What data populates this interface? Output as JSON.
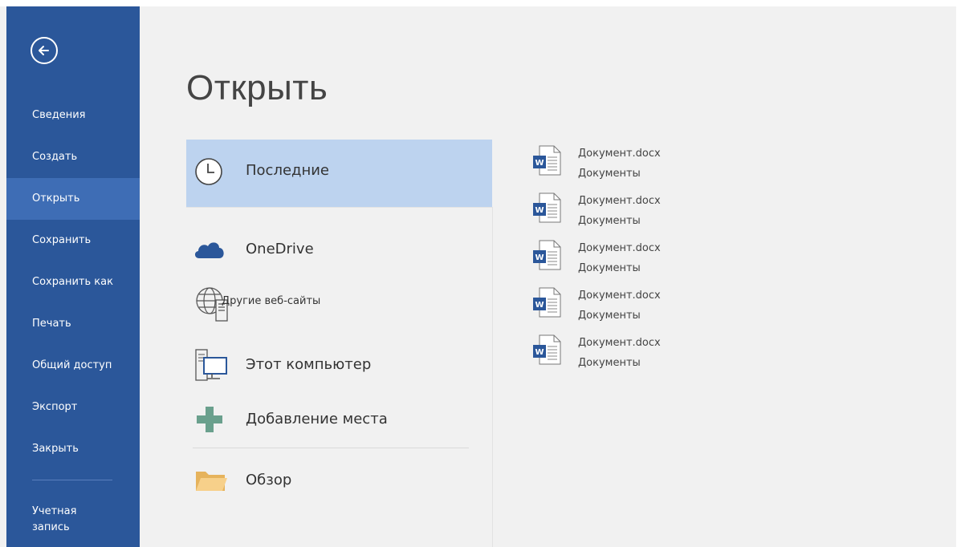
{
  "backstage": {
    "title": "Открыть"
  },
  "nav": {
    "items": [
      {
        "label": "Сведения"
      },
      {
        "label": "Создать"
      },
      {
        "label": "Открыть"
      },
      {
        "label": "Сохранить"
      },
      {
        "label": "Сохранить как"
      },
      {
        "label": "Печать"
      },
      {
        "label": "Общий доступ"
      },
      {
        "label": "Экспорт"
      },
      {
        "label": "Закрыть"
      }
    ],
    "account_line1": "Учетная",
    "account_line2": "запись",
    "active_item": "Открыть"
  },
  "places": {
    "recent": {
      "label": "Последние",
      "icon": "clock-icon"
    },
    "onedrive": {
      "label": "OneDrive",
      "icon": "cloud-icon"
    },
    "other_sites": {
      "label": "Другие веб-сайты",
      "icon": "globe-server-icon"
    },
    "this_pc": {
      "label": "Этот компьютер",
      "icon": "computer-icon"
    },
    "add_place": {
      "label": "Добавление места",
      "icon": "plus-icon"
    },
    "browse": {
      "label": "Обзор",
      "icon": "folder-icon"
    }
  },
  "recent_files": [
    {
      "name": "Документ.docx",
      "location": "Документы"
    },
    {
      "name": "Документ.docx",
      "location": "Документы"
    },
    {
      "name": "Документ.docx",
      "location": "Документы"
    },
    {
      "name": "Документ.docx",
      "location": "Документы"
    },
    {
      "name": "Документ.docx",
      "location": "Документы"
    }
  ],
  "colors": {
    "sidebar": "#2b579a",
    "sidebar_active": "#3e6db5",
    "selected_place": "#bdd3ef",
    "cloud": "#2b579a",
    "plus": "#6aa08d",
    "folder": "#f2c478"
  }
}
